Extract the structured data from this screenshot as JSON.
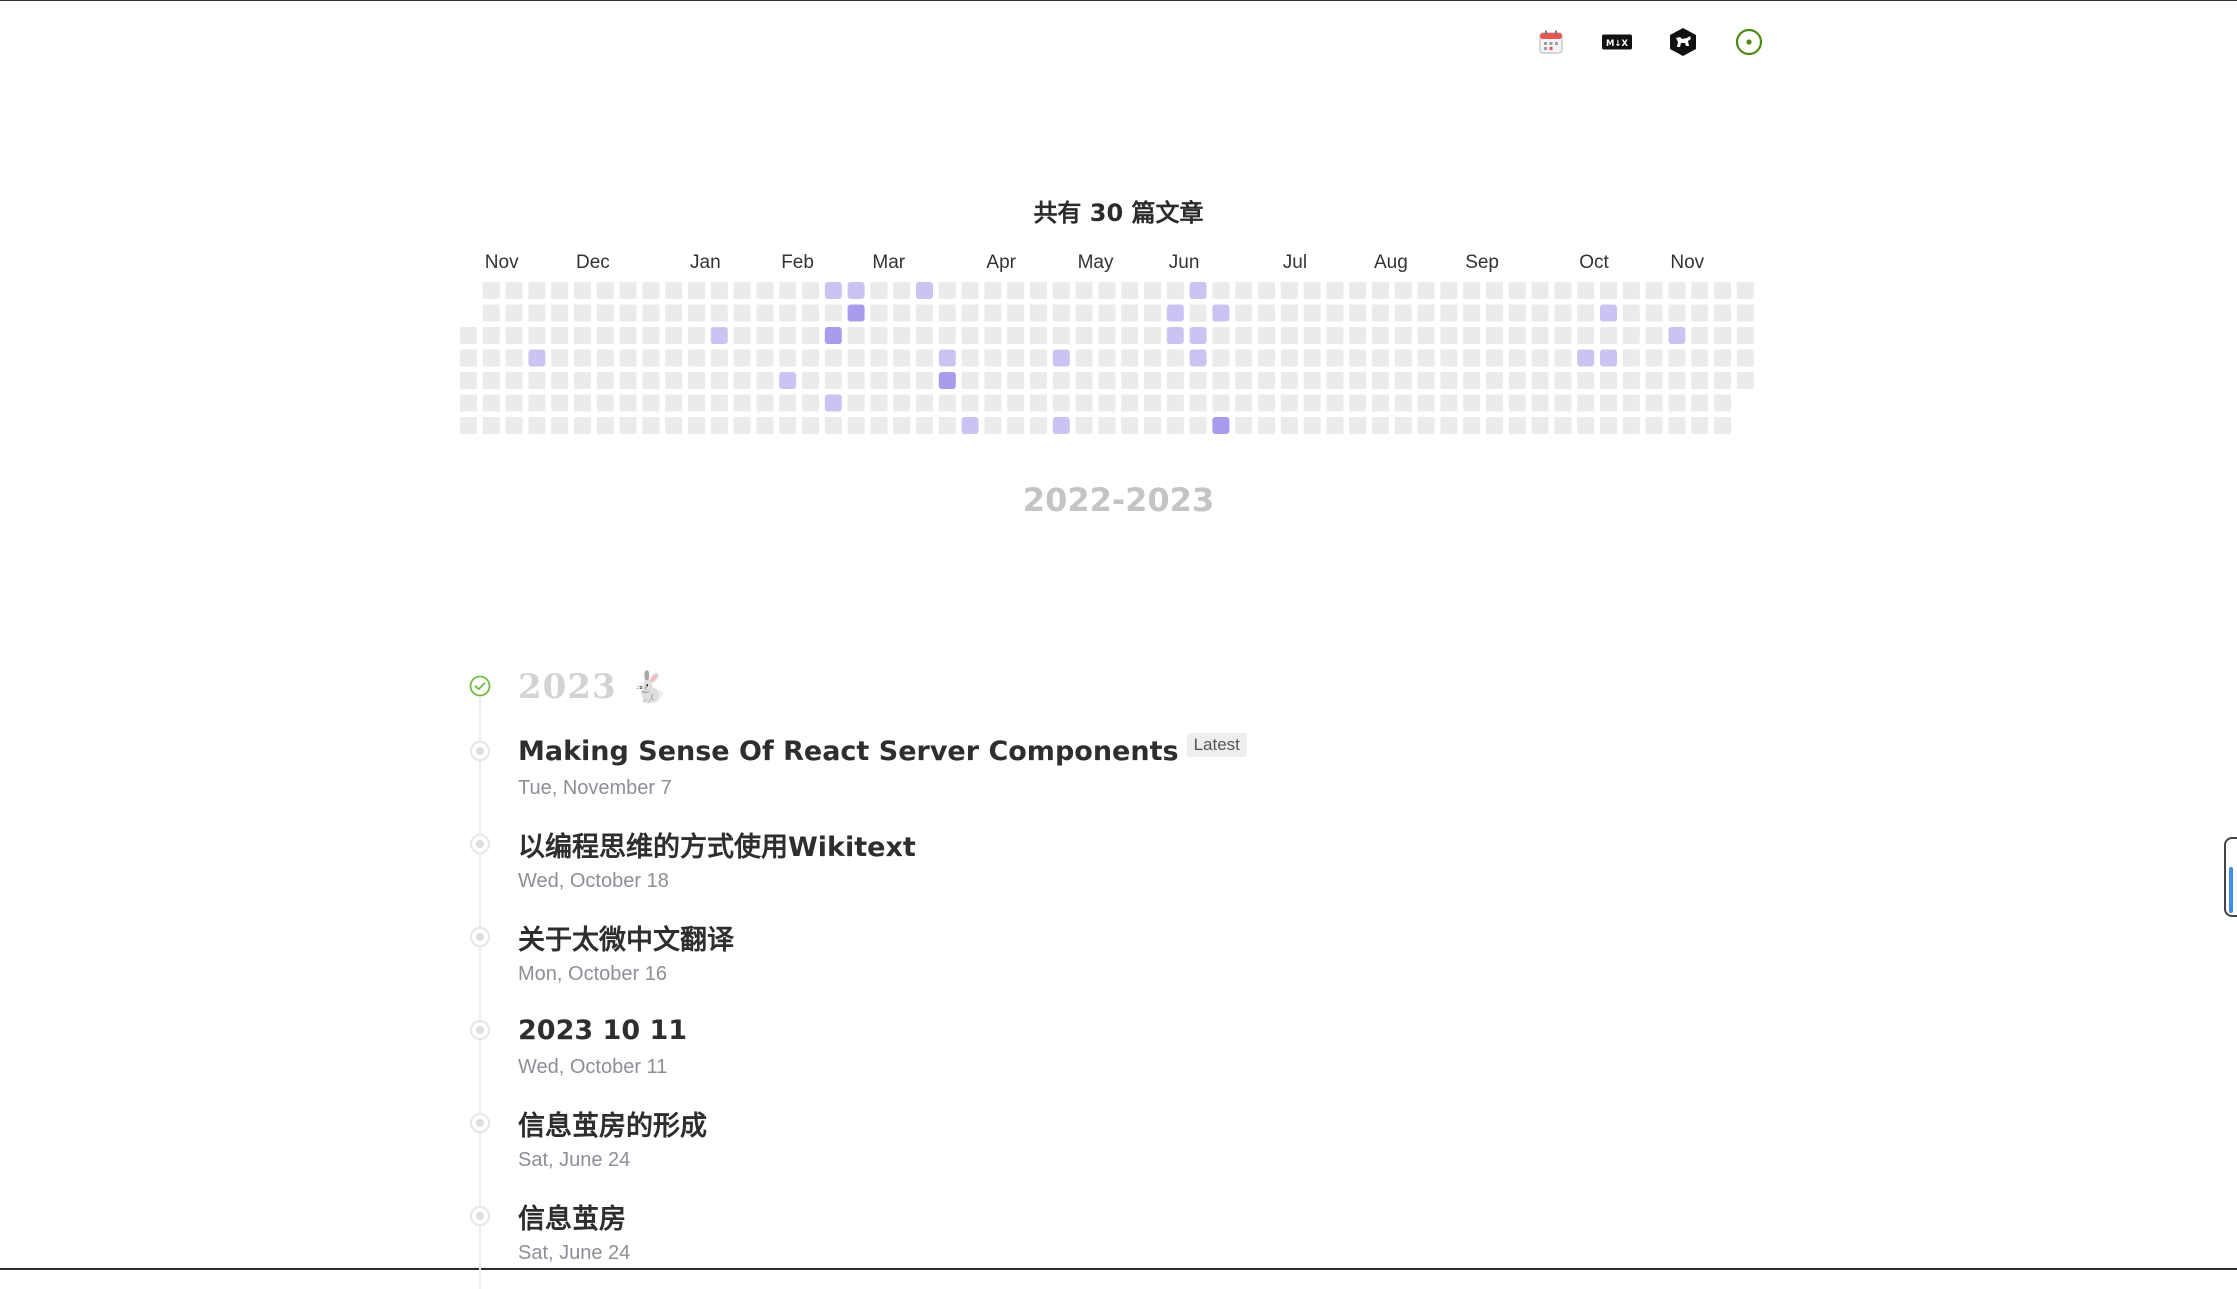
{
  "toolbar": {
    "items": [
      {
        "name": "calendar-icon"
      },
      {
        "name": "mdx-icon",
        "label": "M↓X"
      },
      {
        "name": "tiddlywiki-icon"
      },
      {
        "name": "theme-toggle-icon"
      }
    ]
  },
  "heatmap": {
    "title": "共有 30 篇文章",
    "years": "2022-2023",
    "month_labels": [
      {
        "label": "Nov",
        "col": 1
      },
      {
        "label": "Dec",
        "col": 5
      },
      {
        "label": "Jan",
        "col": 10
      },
      {
        "label": "Feb",
        "col": 14
      },
      {
        "label": "Mar",
        "col": 18
      },
      {
        "label": "Apr",
        "col": 23
      },
      {
        "label": "May",
        "col": 27
      },
      {
        "label": "Jun",
        "col": 31
      },
      {
        "label": "Jul",
        "col": 36
      },
      {
        "label": "Aug",
        "col": 40
      },
      {
        "label": "Sep",
        "col": 44
      },
      {
        "label": "Oct",
        "col": 49
      },
      {
        "label": "Nov",
        "col": 53
      }
    ],
    "weeks": 57,
    "first_week_start_day": 2,
    "last_week_end_day": 4,
    "active": [
      {
        "col": 16,
        "day": 0,
        "level": 1
      },
      {
        "col": 17,
        "day": 0,
        "level": 1
      },
      {
        "col": 20,
        "day": 0,
        "level": 1
      },
      {
        "col": 32,
        "day": 0,
        "level": 1
      },
      {
        "col": 17,
        "day": 1,
        "level": 2
      },
      {
        "col": 31,
        "day": 1,
        "level": 1
      },
      {
        "col": 33,
        "day": 1,
        "level": 1
      },
      {
        "col": 50,
        "day": 1,
        "level": 1
      },
      {
        "col": 11,
        "day": 2,
        "level": 1
      },
      {
        "col": 16,
        "day": 2,
        "level": 2
      },
      {
        "col": 31,
        "day": 2,
        "level": 1
      },
      {
        "col": 32,
        "day": 2,
        "level": 1
      },
      {
        "col": 53,
        "day": 2,
        "level": 1
      },
      {
        "col": 3,
        "day": 3,
        "level": 1
      },
      {
        "col": 21,
        "day": 3,
        "level": 1
      },
      {
        "col": 26,
        "day": 3,
        "level": 1
      },
      {
        "col": 32,
        "day": 3,
        "level": 1
      },
      {
        "col": 49,
        "day": 3,
        "level": 1
      },
      {
        "col": 50,
        "day": 3,
        "level": 1
      },
      {
        "col": 14,
        "day": 4,
        "level": 1
      },
      {
        "col": 21,
        "day": 4,
        "level": 2
      },
      {
        "col": 16,
        "day": 5,
        "level": 1
      },
      {
        "col": 22,
        "day": 6,
        "level": 1
      },
      {
        "col": 26,
        "day": 6,
        "level": 1
      },
      {
        "col": 33,
        "day": 6,
        "level": 2
      }
    ],
    "colors": {
      "empty": "#ebebee",
      "level1": "#cbc4f3",
      "level2": "#a99bed"
    }
  },
  "timeline": {
    "year": "2023",
    "year_emoji": "🐇",
    "year_icon": "check-circle-icon",
    "accent": "#6fbf3f",
    "posts": [
      {
        "title": "Making Sense Of React Server Components",
        "badge": "Latest",
        "date": "Tue, November 7"
      },
      {
        "title": "以编程思维的方式使用Wikitext",
        "date": "Wed, October 18"
      },
      {
        "title": "关于太微中文翻译",
        "date": "Mon, October 16"
      },
      {
        "title": "2023 10 11",
        "date": "Wed, October 11"
      },
      {
        "title": "信息茧房的形成",
        "date": "Sat, June 24"
      },
      {
        "title": "信息茧房",
        "date": "Sat, June 24"
      }
    ]
  }
}
